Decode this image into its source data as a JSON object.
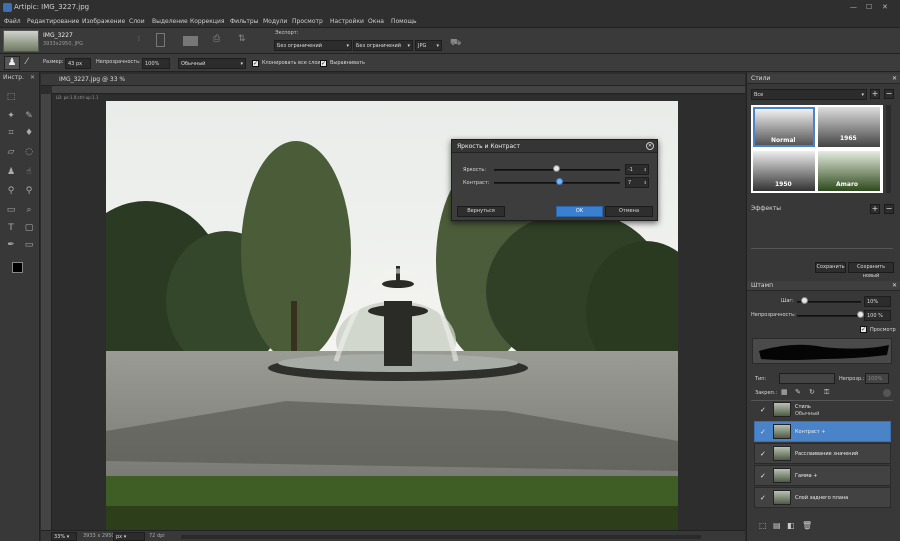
{
  "app": {
    "title": "Artipic: IMG_3227.jpg"
  },
  "menu": [
    "Файл",
    "Редактирование",
    "Изображение",
    "Слои",
    "Выделение",
    "Коррекция",
    "Фильтры",
    "Модули",
    "Просмотр",
    "Настройки",
    "Окна",
    "Помощь"
  ],
  "doc": {
    "name": "IMG_3227",
    "info": "3933x2950, JPG"
  },
  "export": {
    "label": "Экспорт:",
    "size1": "Без ограничений",
    "size2": "Без ограничений",
    "format": "JPG"
  },
  "options": {
    "size_label": "Размер:",
    "size_value": "43 px",
    "opacity_label": "Непрозрачность:",
    "opacity_value": "100%",
    "mode": "Обычный",
    "clone_all": "Клонировать все слои",
    "align": "Выравнивать"
  },
  "tools_panel": {
    "title": "Инстр."
  },
  "canvas": {
    "tab": "IMG_3227.jpg @ 33 %",
    "ruler_note": "LB: pe:1.0;ctrl-up:1.1",
    "zoom": "33%",
    "dims": "3933 x 2950",
    "unit": "px",
    "dpi": "72 dpi"
  },
  "dialog": {
    "title": "Яркость и Контраст",
    "brightness_label": "Яркость:",
    "brightness_value": "-1",
    "brightness_frac": 0.5,
    "contrast_label": "Контраст:",
    "contrast_value": "7",
    "contrast_frac": 0.52,
    "reset": "Вернуться",
    "ok": "OK",
    "cancel": "Отмена"
  },
  "styles": {
    "title": "Стили",
    "filter": "Все",
    "presets": [
      "Normal",
      "1965",
      "1950",
      "Amaro"
    ],
    "effects": "Эффекты",
    "save": "Сохранить",
    "save_new": "Сохранить новый"
  },
  "brush": {
    "title": "Штамп",
    "step_label": "Шаг:",
    "step_value": "10%",
    "step_frac": 0.12,
    "opacity_label": "Непрозрачность:",
    "opacity_value": "100 %",
    "opacity_frac": 1.0,
    "preview": "Просмотр"
  },
  "layers": {
    "type_label": "Тип:",
    "opacity_label": "Непрозр.:",
    "opacity_value": "100%",
    "lock_label": "Закреп.:",
    "items": [
      {
        "name": "Стиль",
        "sub": "Обычный",
        "selected": false
      },
      {
        "name": "Контраст +",
        "sub": "",
        "selected": true
      },
      {
        "name": "Расслаивание значений",
        "sub": "",
        "selected": false
      },
      {
        "name": "Гамма +",
        "sub": "",
        "selected": false
      },
      {
        "name": "Слой заднего плана",
        "sub": "",
        "selected": false
      }
    ]
  }
}
